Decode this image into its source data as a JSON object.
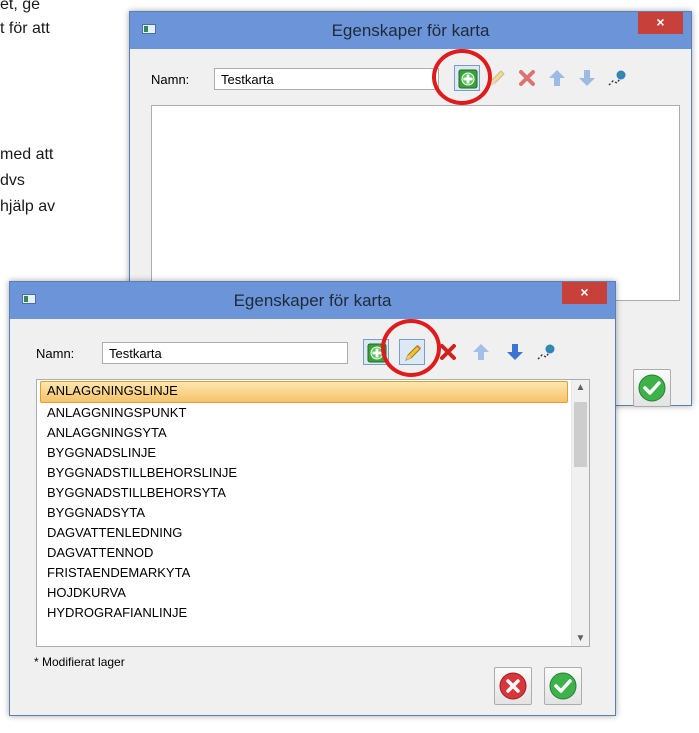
{
  "background_text": [
    "et, ge",
    "t för att",
    "med att",
    "dvs",
    "hjälp av"
  ],
  "back_window": {
    "title": "Egenskaper för karta",
    "close_glyph": "×",
    "name_label": "Namn:",
    "name_value": "Testkarta"
  },
  "front_window": {
    "title": "Egenskaper för karta",
    "close_glyph": "×",
    "name_label": "Namn:",
    "name_value": "Testkarta",
    "layers": [
      "ANLAGGNINGSLINJE",
      "ANLAGGNINGSPUNKT",
      "ANLAGGNINGSYTA",
      "BYGGNADSLINJE",
      "BYGGNADSTILLBEHORSLINJE",
      "BYGGNADSTILLBEHORSYTA",
      "BYGGNADSYTA",
      "DAGVATTENLEDNING",
      "DAGVATTENNOD",
      "FRISTAENDEMARKYTA",
      "HOJDKURVA",
      "HYDROGRAFIANLINJE"
    ],
    "selected_layer": "ANLAGGNINGSLINJE",
    "footnote": "* Modifierat lager"
  },
  "icons": {
    "add": "add-layer-icon",
    "edit": "pencil-icon",
    "delete": "delete-x-icon",
    "up": "move-up-arrow-icon",
    "down": "move-down-arrow-icon",
    "layer": "map-layer-icon",
    "ok": "ok-check-icon",
    "cancel": "cancel-x-icon"
  },
  "colors": {
    "titlebar": "#6b95d8",
    "close": "#c7413a",
    "highlight_ring": "#e01b1b",
    "selection": "#f7c26a"
  }
}
